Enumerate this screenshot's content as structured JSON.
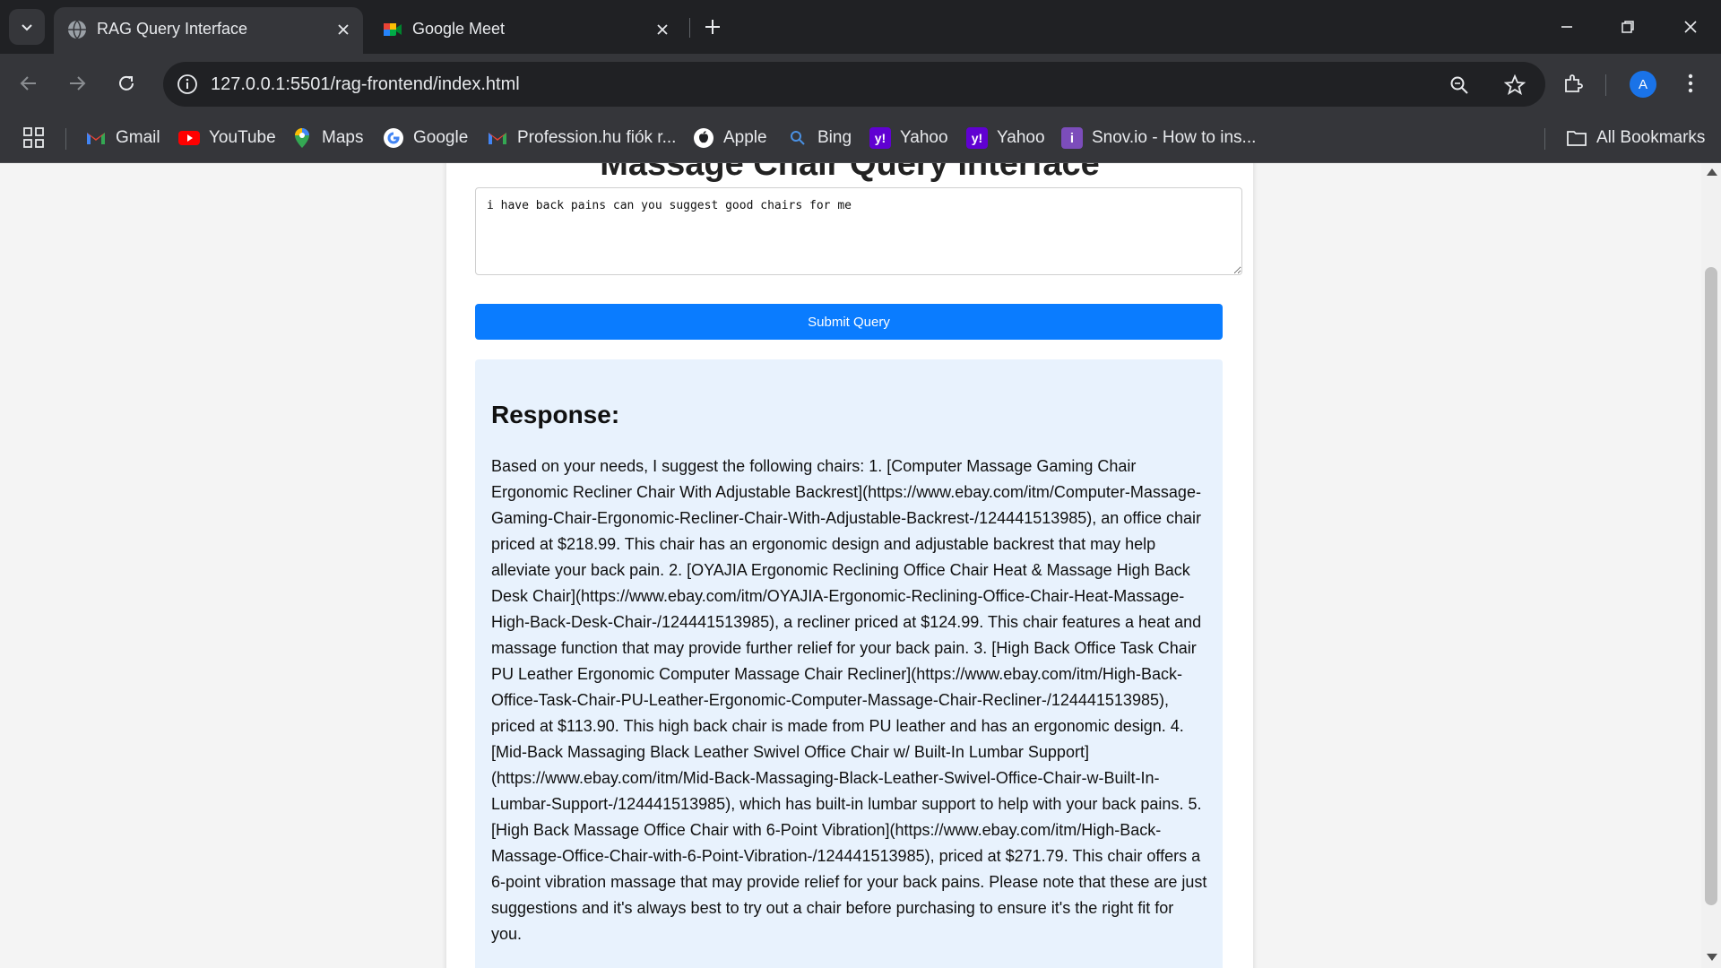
{
  "browser": {
    "tabs": [
      {
        "title": "RAG Query Interface",
        "active": true
      },
      {
        "title": "Google Meet",
        "active": false
      }
    ],
    "url": "127.0.0.1:5501/rag-frontend/index.html",
    "profile_initial": "A",
    "bookmarks": [
      {
        "label": "Gmail",
        "icon": "gmail-icon"
      },
      {
        "label": "YouTube",
        "icon": "youtube-icon"
      },
      {
        "label": "Maps",
        "icon": "maps-icon"
      },
      {
        "label": "Google",
        "icon": "google-icon"
      },
      {
        "label": "Profession.hu fiók r...",
        "icon": "gmail-icon"
      },
      {
        "label": "Apple",
        "icon": "apple-icon"
      },
      {
        "label": "Bing",
        "icon": "search-icon"
      },
      {
        "label": "Yahoo",
        "icon": "yahoo-icon"
      },
      {
        "label": "Yahoo",
        "icon": "yahoo-icon"
      },
      {
        "label": "Snov.io - How to ins...",
        "icon": "info-icon"
      }
    ],
    "all_bookmarks_label": "All Bookmarks"
  },
  "page": {
    "title": "Massage Chair Query Interface",
    "query_value": "i have back pains can you suggest good chairs for me",
    "submit_label": "Submit Query",
    "response_heading": "Response:",
    "response_text": "Based on your needs, I suggest the following chairs: 1. [Computer Massage Gaming Chair Ergonomic Recliner Chair With Adjustable Backrest](https://www.ebay.com/itm/Computer-Massage-Gaming-Chair-Ergonomic-Recliner-Chair-With-Adjustable-Backrest-/124441513985), an office chair priced at $218.99. This chair has an ergonomic design and adjustable backrest that may help alleviate your back pain. 2. [OYAJIA Ergonomic Reclining Office Chair Heat & Massage High Back Desk Chair](https://www.ebay.com/itm/OYAJIA-Ergonomic-Reclining-Office-Chair-Heat-Massage-High-Back-Desk-Chair-/124441513985), a recliner priced at $124.99. This chair features a heat and massage function that may provide further relief for your back pain. 3. [High Back Office Task Chair PU Leather Ergonomic Computer Massage Chair Recliner](https://www.ebay.com/itm/High-Back-Office-Task-Chair-PU-Leather-Ergonomic-Computer-Massage-Chair-Recliner-/124441513985), priced at $113.90. This high back chair is made from PU leather and has an ergonomic design. 4. [Mid-Back Massaging Black Leather Swivel Office Chair w/ Built-In Lumbar Support](https://www.ebay.com/itm/Mid-Back-Massaging-Black-Leather-Swivel-Office-Chair-w-Built-In-Lumbar-Support-/124441513985), which has built-in lumbar support to help with your back pains. 5. [High Back Massage Office Chair with 6-Point Vibration](https://www.ebay.com/itm/High-Back-Massage-Office-Chair-with-6-Point-Vibration-/124441513985), priced at $271.79. This chair offers a 6-point vibration massage that may provide relief for your back pains. Please note that these are just suggestions and it's always best to try out a chair before purchasing to ensure it's the right fit for you."
  },
  "colors": {
    "accent": "#0a7cff",
    "response_bg": "#e8f2fd",
    "chrome_dark": "#202124",
    "chrome_toolbar": "#35363a"
  }
}
